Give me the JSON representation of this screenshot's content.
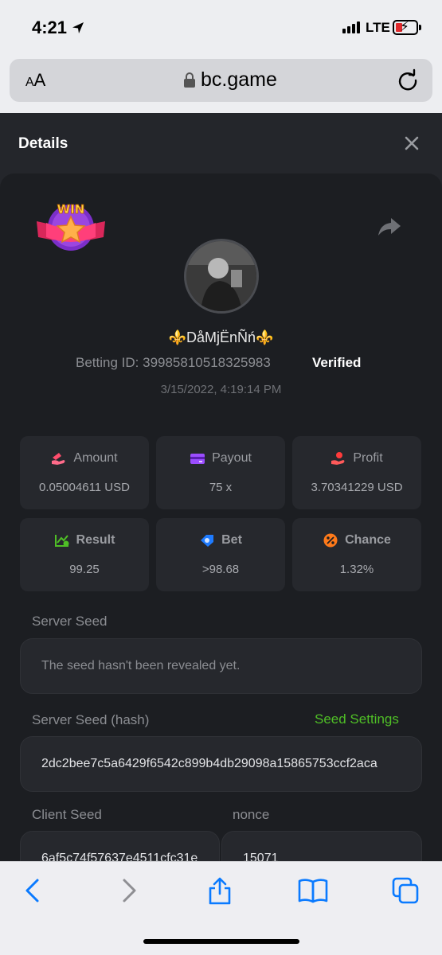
{
  "status_bar": {
    "time": "4:21",
    "network": "LTE"
  },
  "browser": {
    "text_size_label_small": "A",
    "text_size_label_large": "A",
    "url": "bc.game"
  },
  "modal": {
    "title": "Details"
  },
  "bet": {
    "username": "⚜️DåMjËnÑń⚜️",
    "betting_id_label": "Betting ID:",
    "betting_id": "39985810518325983",
    "verified_label": "Verified",
    "timestamp": "3/15/2022, 4:19:14 PM"
  },
  "badge": {
    "text": "WIN"
  },
  "stats": {
    "amount": {
      "label": "Amount",
      "value": "0.05004611 USD"
    },
    "payout": {
      "label": "Payout",
      "value": "75 x"
    },
    "profit": {
      "label": "Profit",
      "value": "3.70341229 USD"
    },
    "result": {
      "label": "Result",
      "value": "99.25"
    },
    "bet": {
      "label": "Bet",
      "value": ">98.68"
    },
    "chance": {
      "label": "Chance",
      "value": "1.32%"
    }
  },
  "seeds": {
    "server_seed_label": "Server Seed",
    "server_seed_value": "The seed hasn't been revealed yet.",
    "server_seed_hash_label": "Server Seed (hash)",
    "seed_settings_link": "Seed Settings",
    "server_seed_hash_value": "2dc2bee7c5a6429f6542c899b4db29098a15865753ccf2aca",
    "client_seed_label": "Client Seed",
    "client_seed_value": "6af5c74f57637e4511cfc31e",
    "nonce_label": "nonce",
    "nonce_value": "15071"
  },
  "colors": {
    "accent_green": "#4fbf26",
    "panel_bg": "#1c1e22",
    "card_bg": "#26282d",
    "ios_blue": "#0a7aff"
  }
}
